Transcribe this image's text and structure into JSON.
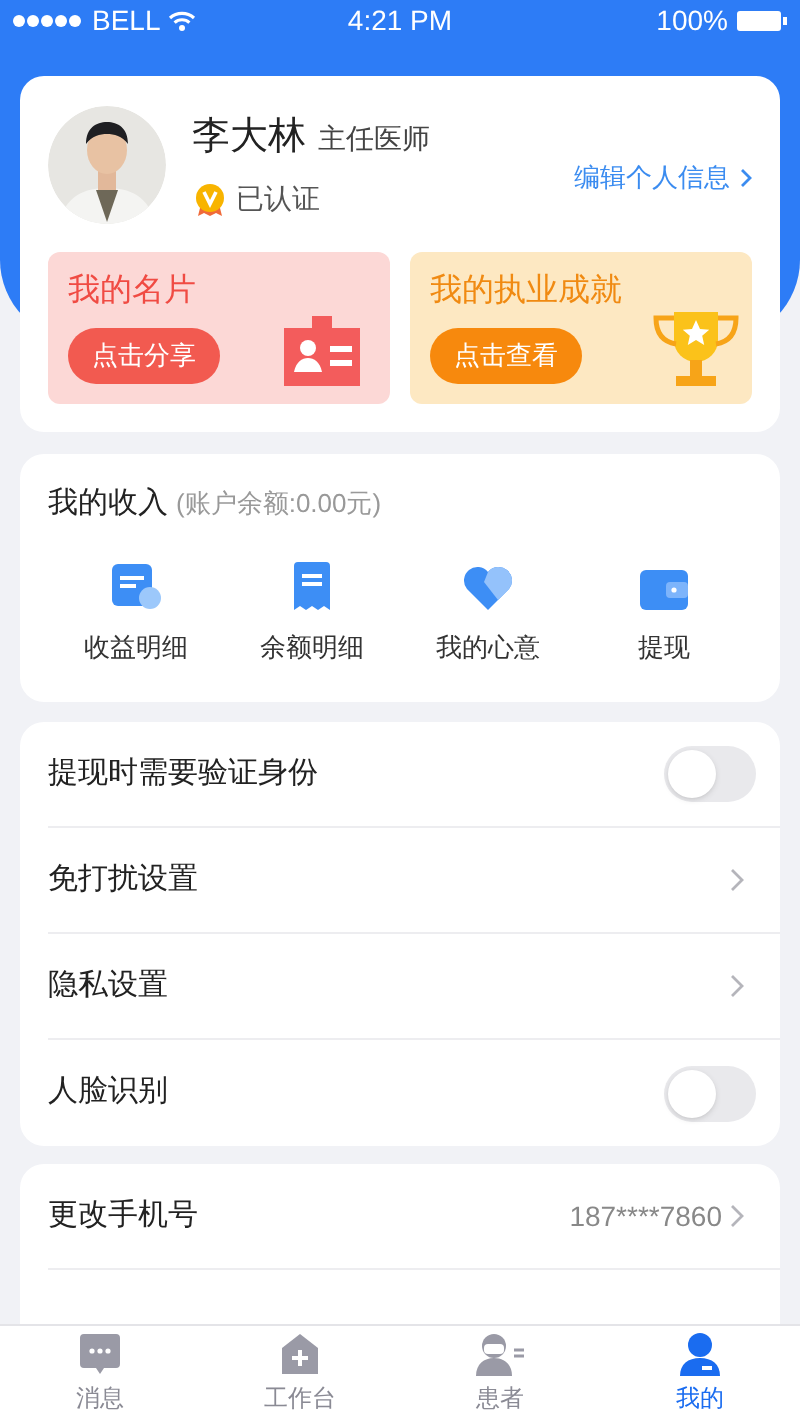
{
  "status_bar": {
    "carrier": "BELL",
    "time": "4:21 PM",
    "battery": "100%"
  },
  "profile": {
    "name": "李大林",
    "title": "主任医师",
    "badge": "已认证",
    "edit_link": "编辑个人信息"
  },
  "promo_cards": [
    {
      "kind": "card",
      "title": "我的名片",
      "button": "点击分享"
    },
    {
      "kind": "trophy",
      "title": "我的执业成就",
      "button": "点击查看"
    }
  ],
  "income": {
    "title": "我的收入",
    "balance": "(账户余额:0.00元)",
    "items": [
      {
        "kind": "receipt-coin",
        "label": "收益明细"
      },
      {
        "kind": "receipt",
        "label": "余额明细"
      },
      {
        "kind": "heart",
        "label": "我的心意"
      },
      {
        "kind": "wallet",
        "label": "提现"
      }
    ]
  },
  "settings": [
    {
      "kind": "toggle",
      "label": "提现时需要验证身份",
      "on": false
    },
    {
      "kind": "link",
      "label": "免打扰设置"
    },
    {
      "kind": "link",
      "label": "隐私设置"
    },
    {
      "kind": "toggle",
      "label": "人脸识别",
      "on": false
    }
  ],
  "account": [
    {
      "kind": "link",
      "label": "更改手机号",
      "value": "187****7860"
    }
  ],
  "tab_bar": [
    {
      "kind": "chat",
      "label": "消息",
      "selected": false
    },
    {
      "kind": "house",
      "label": "工作台",
      "selected": false
    },
    {
      "kind": "patient",
      "label": "患者",
      "selected": false
    },
    {
      "kind": "person",
      "label": "我的",
      "selected": true
    }
  ]
}
